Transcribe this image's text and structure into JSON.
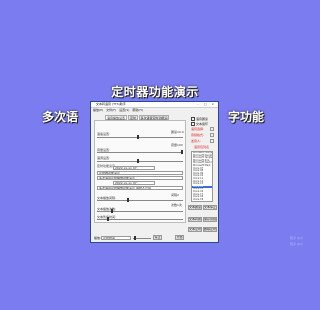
{
  "overlay": {
    "title": "定时器功能演示",
    "subtitle_left": "多次语",
    "subtitle_right": "字功能",
    "watermark_1": "知乎 @小",
    "watermark_2": "知乎 @小"
  },
  "window": {
    "title": "文本转语音 (TTS)助手",
    "controls": "– □ ×",
    "menu": [
      "播放(P)",
      "文件(F)",
      "设置(S)",
      "帮助(H)"
    ],
    "tabs": [
      "语音播放设置",
      "定时",
      "多次语音定时功能演示"
    ],
    "rows": [
      {
        "label": "语速设置:",
        "value": "朗读10.0"
      },
      {
        "label": "音量设置:",
        "value": "音量100"
      },
      {
        "label": "语调设置:",
        "value": ""
      },
      {
        "label": "定时功能演示",
        "value": ""
      },
      {
        "label": "定时器功能演示",
        "value": ""
      },
      {
        "label": "多次语音定时播放功能演示",
        "value": ""
      },
      {
        "label": "文本播放间隔:",
        "value": "间隔2"
      },
      {
        "label": "文本播放次数:",
        "value": "次数1次"
      },
      {
        "label": "文本暂停时间:",
        "value": ""
      }
    ],
    "field_a": "2022-xx-xx 07:",
    "field_b": "多次语音定时播放功能演示",
    "field_c": "2022-xx-xx 07:",
    "field_d": "多次语音定时播放功能演示  用时不计算",
    "status_label": "播放:",
    "status_value": "定时时间",
    "stop_button": "停止",
    "play_button": "开始",
    "right": {
      "check_1": "语音朗读",
      "check_2": "文本循环",
      "label_1": "语音选择:",
      "label_2": "音频格式:",
      "label_3": "发音人:",
      "voice_list_header": "语音包列表",
      "voices": [
        "Microsoft Huihui",
        "Microsoft Kangkang",
        "Microsoft Yaoyao",
        "Microsoft Zira",
        "Microsoft David",
        "Microsoft Mark",
        "Voice 07",
        "Voice 08",
        "Voice 09",
        "Voice 10",
        "Voice 11",
        "Voice 12",
        "Voice 13",
        "Voice 14",
        "Voice 15",
        "Voice 16",
        "Voice 17",
        "Voice 18",
        "Voice 19"
      ],
      "selected_voice": 13,
      "btn_1": "文本朗读",
      "btn_2": "文本停止",
      "btn_3": "文本转换",
      "btn_4": "保存音频",
      "btn_5": "文本定时",
      "btn_6": "删除定时"
    }
  }
}
